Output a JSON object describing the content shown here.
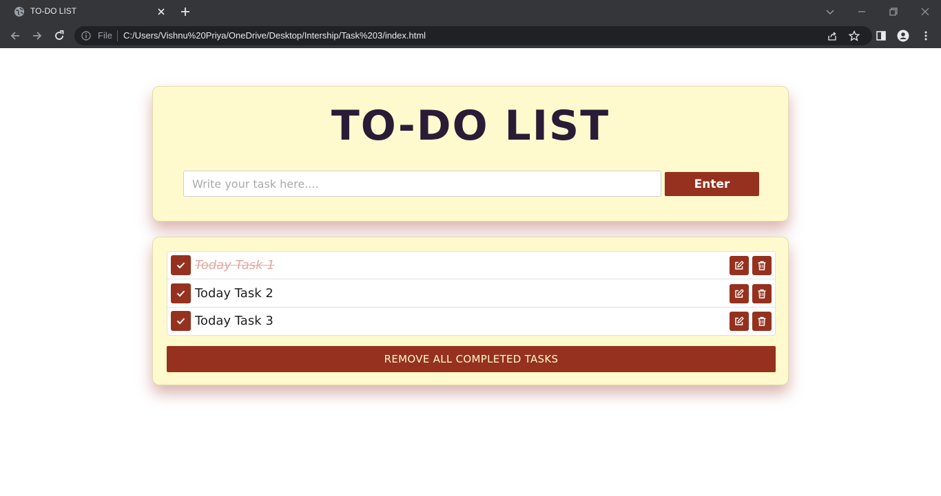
{
  "browser": {
    "tab_title": "TO-DO LIST",
    "file_label": "File",
    "url": "C:/Users/Vishnu%20Priya/OneDrive/Desktop/Intership/Task%203/index.html"
  },
  "app": {
    "title": "TO-DO LIST",
    "input_placeholder": "Write your task here....",
    "input_value": "",
    "enter_label": "Enter",
    "tasks": [
      {
        "text": "Today Task 1",
        "completed": true
      },
      {
        "text": "Today Task 2",
        "completed": false
      },
      {
        "text": "Today Task 3",
        "completed": false
      }
    ],
    "remove_completed_label": "REMOVE ALL COMPLETED TASKS"
  },
  "colors": {
    "accent": "#95311e",
    "card_bg": "#fefacd",
    "title": "#2a1c36",
    "completed_text": "#e6a8a0"
  },
  "icons": {
    "check": "check-icon",
    "edit": "edit-icon",
    "delete": "trash-icon"
  }
}
